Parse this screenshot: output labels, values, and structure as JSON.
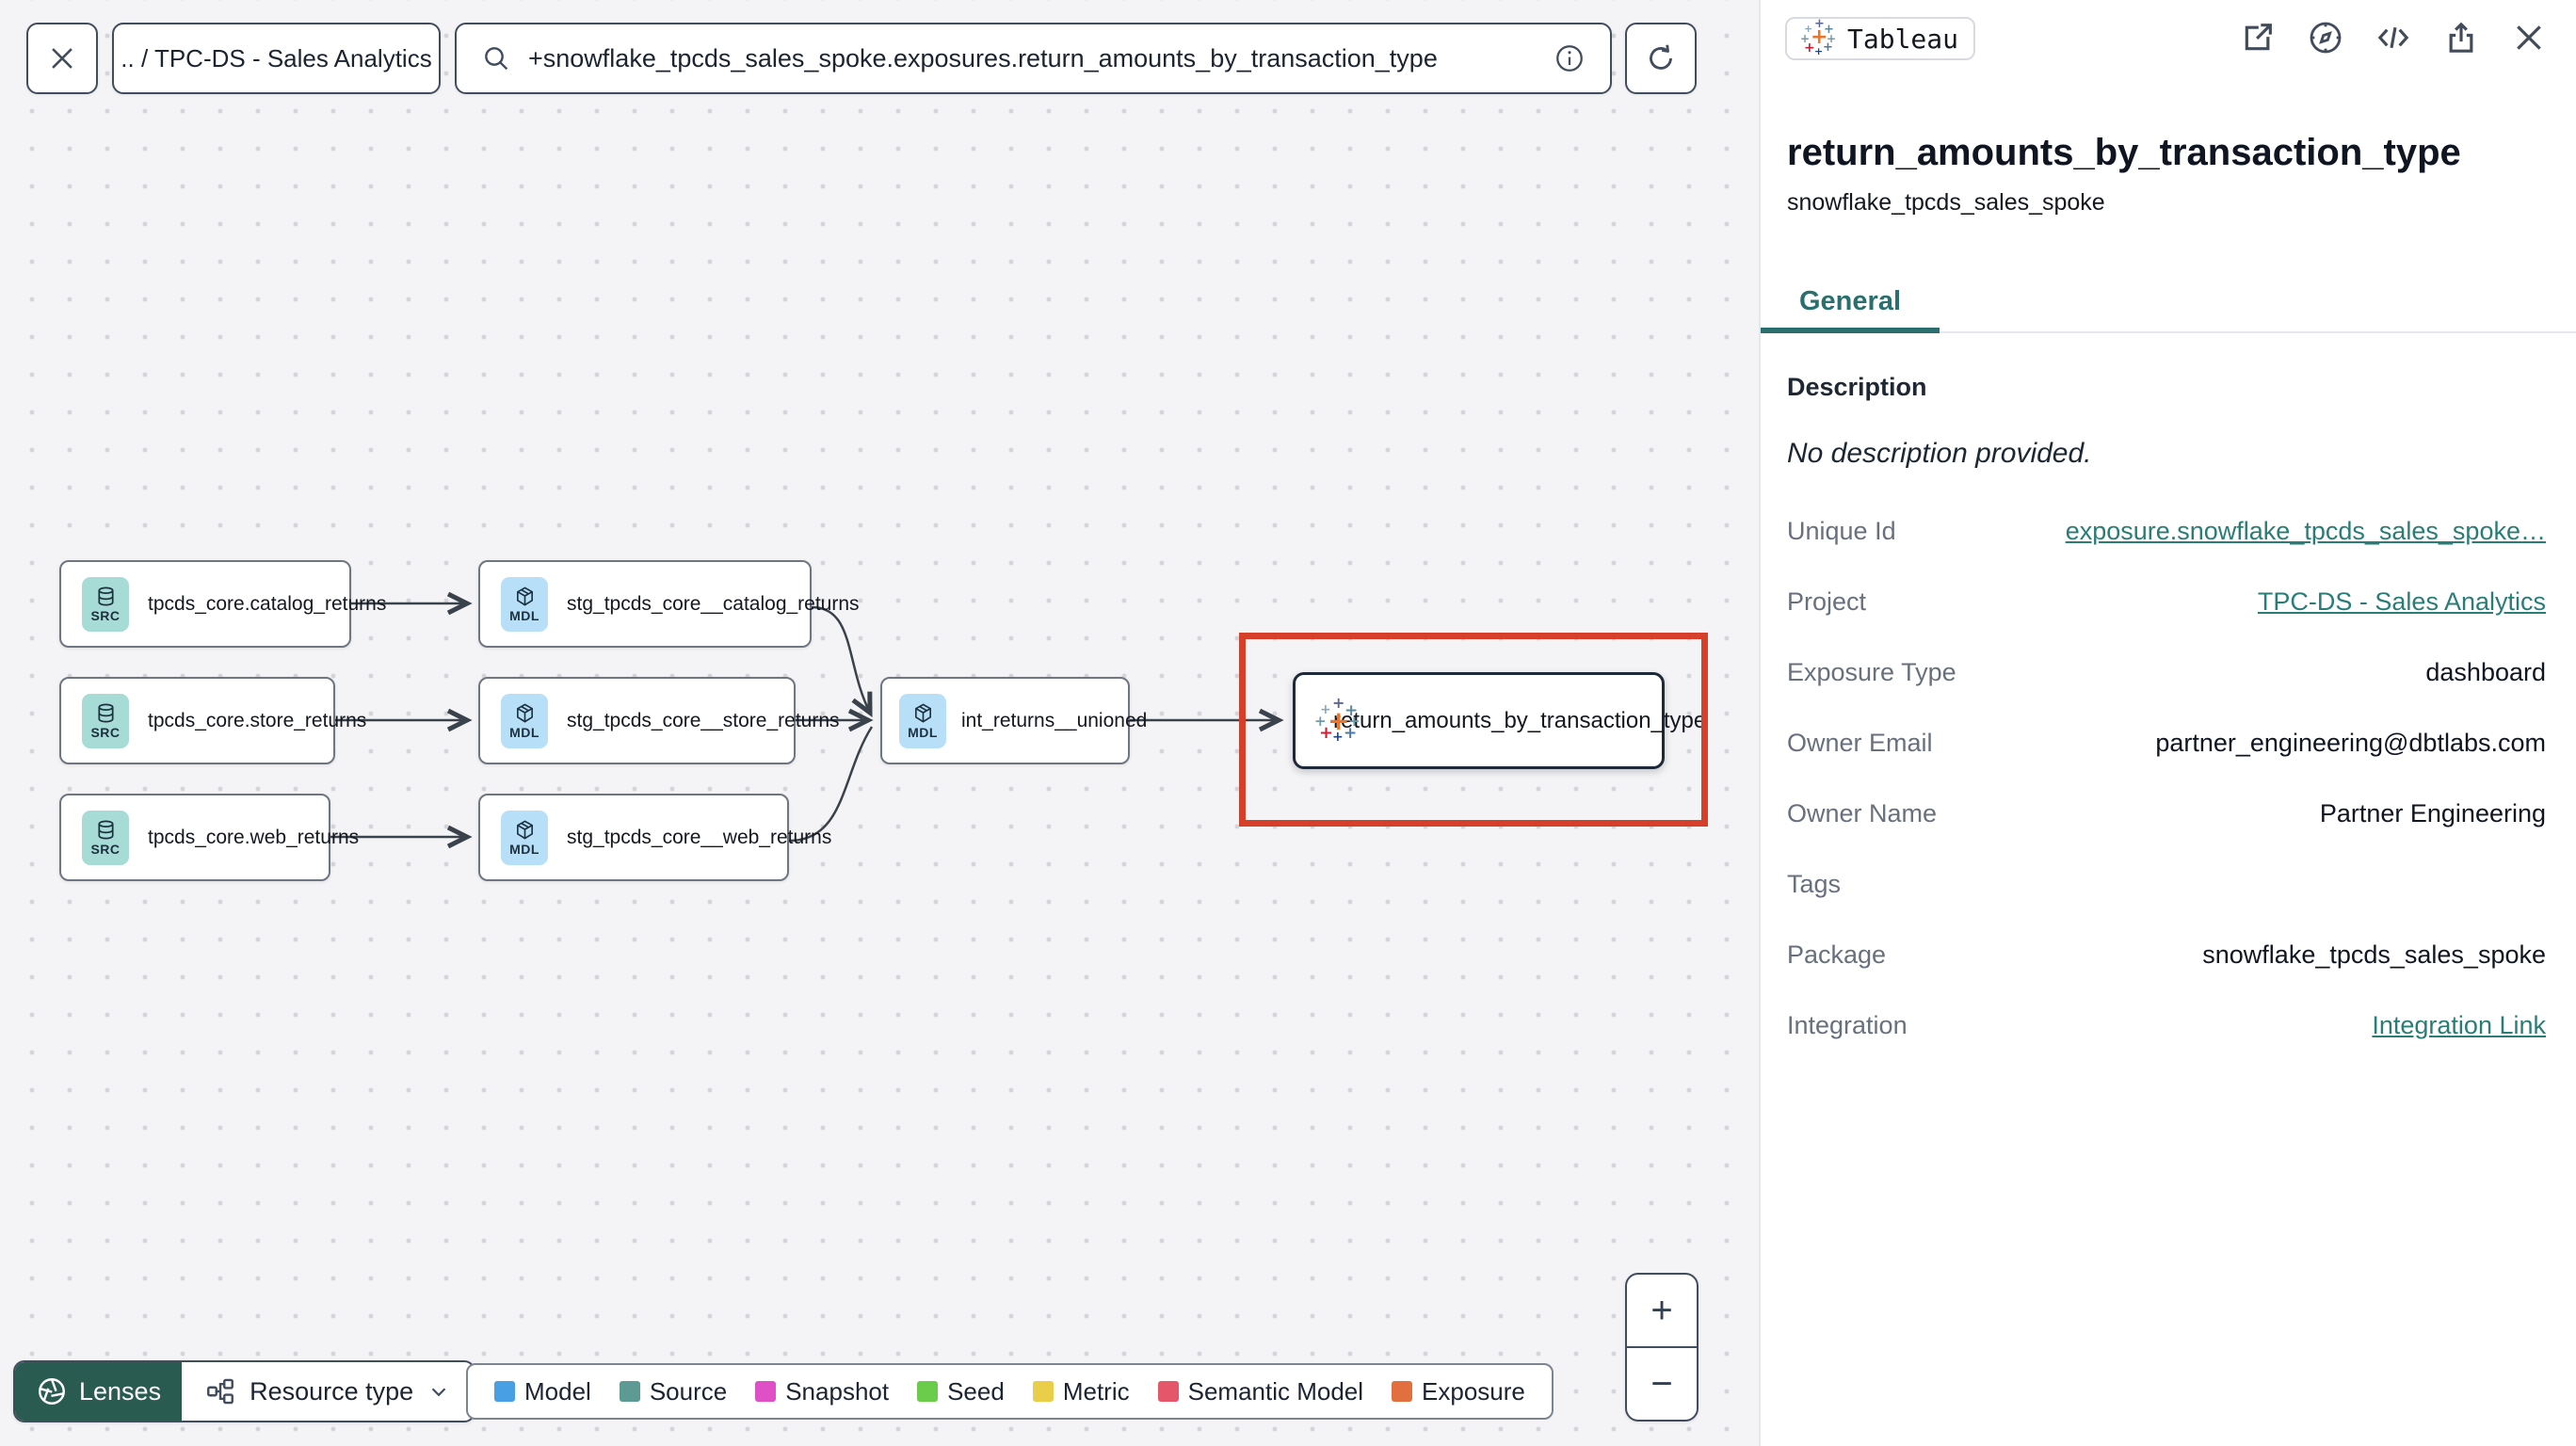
{
  "toolbar": {
    "breadcrumb": ".. / TPC-DS - Sales Analytics",
    "search_value": "+snowflake_tpcds_sales_spoke.exposures.return_amounts_by_transaction_type"
  },
  "graph": {
    "nodes": [
      {
        "label": "tpcds_core.catalog_returns",
        "badge": "SRC",
        "type": "source"
      },
      {
        "label": "stg_tpcds_core__catalog_returns",
        "badge": "MDL",
        "type": "model"
      },
      {
        "label": "tpcds_core.store_returns",
        "badge": "SRC",
        "type": "source"
      },
      {
        "label": "stg_tpcds_core__store_returns",
        "badge": "MDL",
        "type": "model"
      },
      {
        "label": "int_returns__unioned",
        "badge": "MDL",
        "type": "model"
      },
      {
        "label": "tpcds_core.web_returns",
        "badge": "SRC",
        "type": "source"
      },
      {
        "label": "stg_tpcds_core__web_returns",
        "badge": "MDL",
        "type": "model"
      },
      {
        "label": "return_amounts_by_transaction_type",
        "badge": "",
        "type": "exposure-tableau",
        "selected": true
      }
    ],
    "highlight_color": "#d6402b"
  },
  "controls": {
    "lenses_label": "Lenses",
    "resource_type_label": "Resource type",
    "zoom_in": "+",
    "zoom_out": "−"
  },
  "legend": {
    "items": [
      {
        "label": "Model",
        "color": "#489fe3"
      },
      {
        "label": "Source",
        "color": "#5d9a94"
      },
      {
        "label": "Snapshot",
        "color": "#df4fc6"
      },
      {
        "label": "Seed",
        "color": "#6bcb4a"
      },
      {
        "label": "Metric",
        "color": "#eacd49"
      },
      {
        "label": "Semantic Model",
        "color": "#e5566a"
      },
      {
        "label": "Exposure",
        "color": "#e2703f"
      }
    ]
  },
  "panel": {
    "integration_badge": "Tableau",
    "title": "return_amounts_by_transaction_type",
    "subtitle": "snowflake_tpcds_sales_spoke",
    "tab": "General",
    "description_header": "Description",
    "description_text": "No description provided.",
    "fields": [
      {
        "label": "Unique Id",
        "value": "exposure.snowflake_tpcds_sales_spoke…"
      },
      {
        "label": "Project",
        "value": "TPC-DS - Sales Analytics"
      },
      {
        "label": "Exposure Type",
        "value": "dashboard"
      },
      {
        "label": "Owner Email",
        "value": "partner_engineering@dbtlabs.com"
      },
      {
        "label": "Owner Name",
        "value": "Partner Engineering"
      },
      {
        "label": "Tags",
        "value": ""
      },
      {
        "label": "Package",
        "value": "snowflake_tpcds_sales_spoke"
      },
      {
        "label": "Integration",
        "value": "Integration Link"
      }
    ],
    "accent_teal": "#2a6f6d"
  }
}
